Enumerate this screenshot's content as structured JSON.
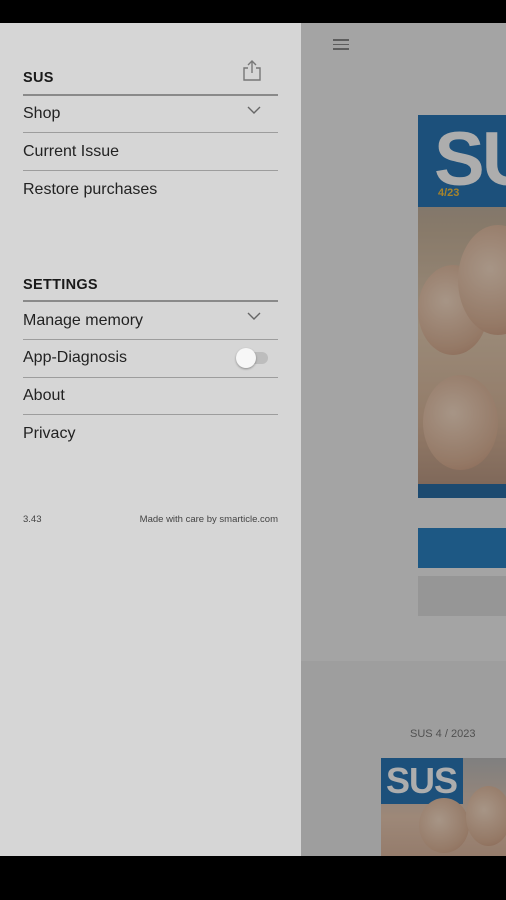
{
  "drawer": {
    "section1_title": "SUS",
    "items1": [
      {
        "label": "Shop",
        "chevron": true
      },
      {
        "label": "Current Issue"
      },
      {
        "label": "Restore purchases"
      }
    ],
    "section2_title": "SETTINGS",
    "items2": [
      {
        "label": "Manage memory",
        "chevron": true
      },
      {
        "label": "App-Diagnosis",
        "toggle": false
      },
      {
        "label": "About"
      },
      {
        "label": "Privacy"
      }
    ],
    "version": "3.43",
    "credit": "Made with care by smarticle.com",
    "share_icon": "share-icon"
  },
  "background": {
    "cover_title": "SUS",
    "cover_issue": "4/23",
    "issue_label": "SUS 4 / 2023",
    "thumb_title": "SUS",
    "accent": "#2c82c3"
  }
}
